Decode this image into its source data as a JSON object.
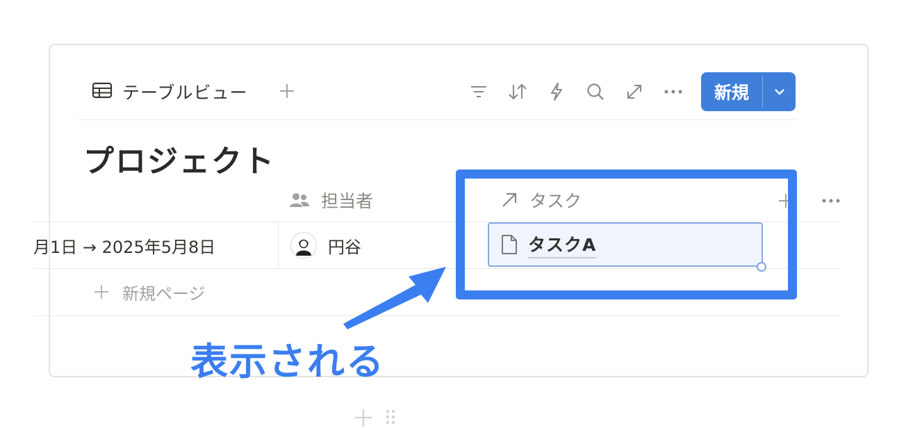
{
  "view": {
    "tab_label": "テーブルビュー",
    "new_button_label": "新規"
  },
  "database": {
    "title": "プロジェクト"
  },
  "columns": {
    "assignee_header": "担当者",
    "task_header": "タスク"
  },
  "row": {
    "date_range": "月1日 → 2025年5月8日",
    "assignee": "円谷",
    "task": "タスクA"
  },
  "new_page_label": "新規ページ",
  "annotation_text": "表示される",
  "colors": {
    "accent": "#3f7fdb",
    "highlight": "#3b7ef0",
    "chip_bg": "#f0f5fd"
  }
}
